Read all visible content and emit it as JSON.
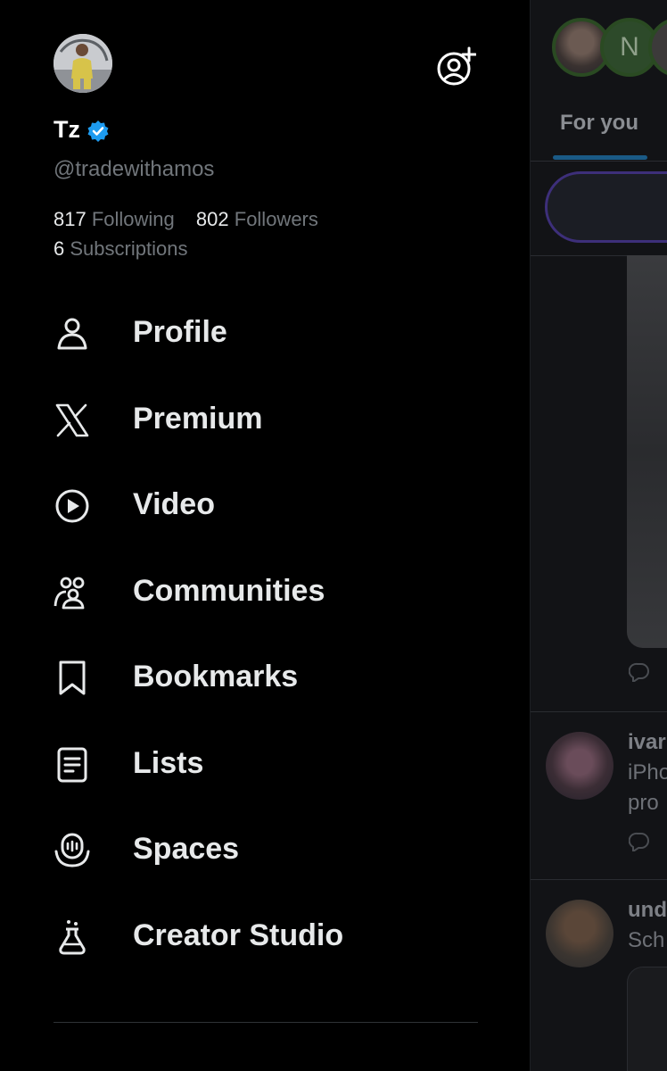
{
  "profile": {
    "display_name": "Tz",
    "handle": "@tradewithamos",
    "following_count": "817",
    "following_label": "Following",
    "followers_count": "802",
    "followers_label": "Followers",
    "subscriptions_count": "6",
    "subscriptions_label": "Subscriptions",
    "verified_color": "#1d9bf0"
  },
  "menu": [
    {
      "label": "Profile",
      "icon": "person-icon"
    },
    {
      "label": "Premium",
      "icon": "x-logo-icon"
    },
    {
      "label": "Video",
      "icon": "play-circle-icon"
    },
    {
      "label": "Communities",
      "icon": "communities-icon"
    },
    {
      "label": "Bookmarks",
      "icon": "bookmark-icon"
    },
    {
      "label": "Lists",
      "icon": "list-icon"
    },
    {
      "label": "Spaces",
      "icon": "spaces-icon"
    },
    {
      "label": "Creator Studio",
      "icon": "flask-icon"
    }
  ],
  "feed": {
    "tab_label": "For you",
    "fleet_letter": "N",
    "post1_name": "ivar",
    "post1_line1": "iPho",
    "post1_line2": "pro",
    "post2_name": "und",
    "post2_line1": "Sch"
  },
  "colors": {
    "background": "#000000",
    "text": "#e7e9ea",
    "muted": "#71767b",
    "accent": "#1d9bf0"
  }
}
